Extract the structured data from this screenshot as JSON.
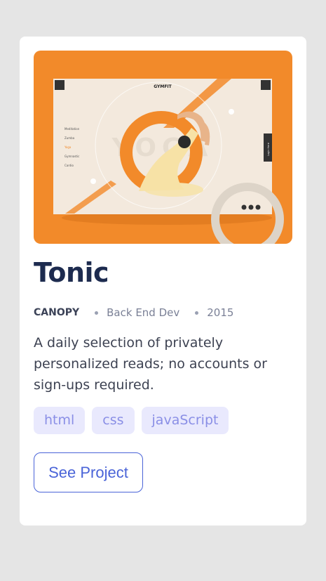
{
  "card": {
    "title": "Tonic",
    "company": "CANOPY",
    "role": "Back End Dev",
    "year": "2015",
    "description": "A daily selection of privately personalized reads; no accounts or sign-ups required.",
    "tags": [
      "html",
      "css",
      "javaScript"
    ],
    "button_label": "See Project"
  },
  "preview": {
    "logo": "GYMFIT",
    "menu": [
      "Meditation",
      "Zumba",
      "Yoga",
      "Gymnastic",
      "Cardio"
    ],
    "watermark": "YOGA",
    "side_tab": "Login Here"
  },
  "colors": {
    "accent": "#f28a2a",
    "title": "#1d2b4f",
    "tag_bg": "#e9e9fd",
    "tag_text": "#8a8fe6",
    "button": "#4a64d8"
  }
}
